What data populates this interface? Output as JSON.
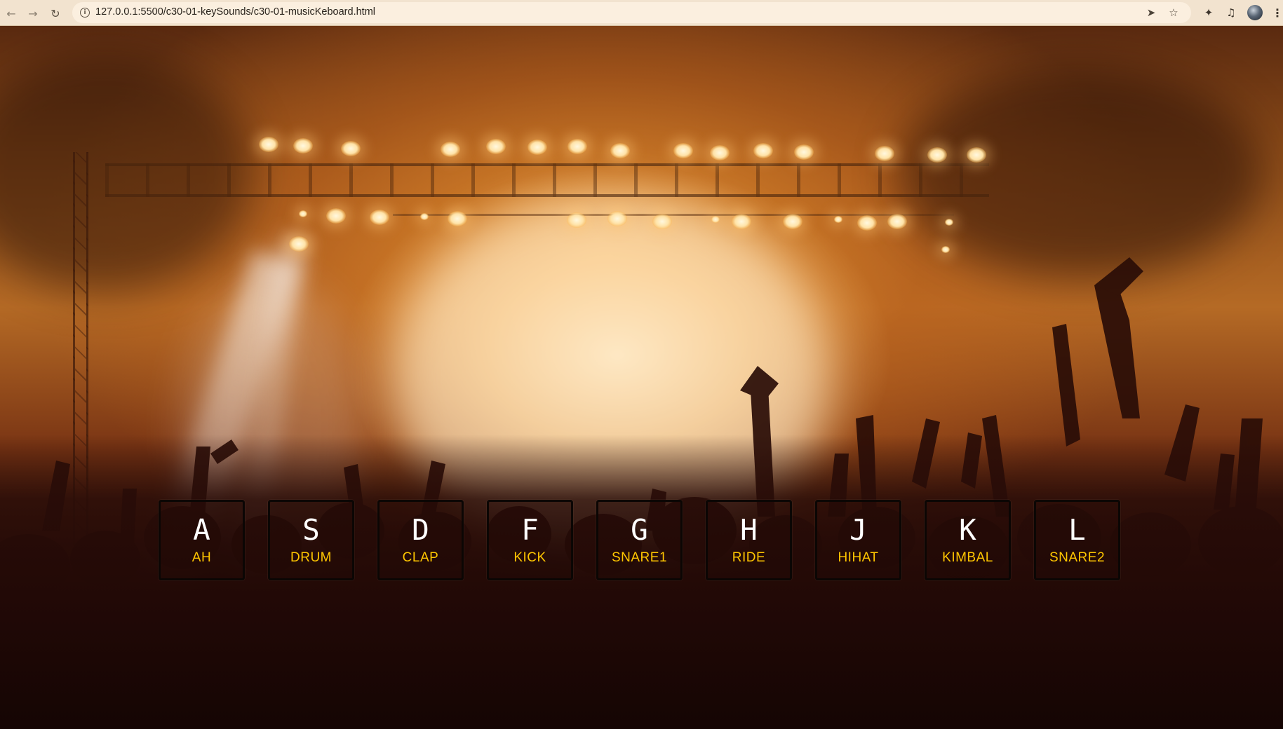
{
  "browser": {
    "url": "127.0.0.1:5500/c30-01-keySounds/c30-01-musicKeboard.html",
    "icons": {
      "back": "arrow-left-icon",
      "forward": "arrow-right-icon",
      "reload": "reload-icon",
      "info": "info-icon",
      "send": "send-icon",
      "bookmark": "star-icon",
      "extensions": "puzzle-icon",
      "media": "media-queue-icon",
      "profile": "avatar",
      "menu": "kebab-menu-icon"
    }
  },
  "keys": [
    {
      "letter": "A",
      "sound": "AH"
    },
    {
      "letter": "S",
      "sound": "DRUM"
    },
    {
      "letter": "D",
      "sound": "CLAP"
    },
    {
      "letter": "F",
      "sound": "KICK"
    },
    {
      "letter": "G",
      "sound": "SNARE1"
    },
    {
      "letter": "H",
      "sound": "RIDE"
    },
    {
      "letter": "J",
      "sound": "HIHAT"
    },
    {
      "letter": "K",
      "sound": "KIMBAL"
    },
    {
      "letter": "L",
      "sound": "SNARE2"
    }
  ],
  "colors": {
    "key_letter": "#ffffff",
    "key_sound": "#ffc600",
    "key_border": "#0b0604",
    "chrome_bg": "#f2e3cf"
  }
}
